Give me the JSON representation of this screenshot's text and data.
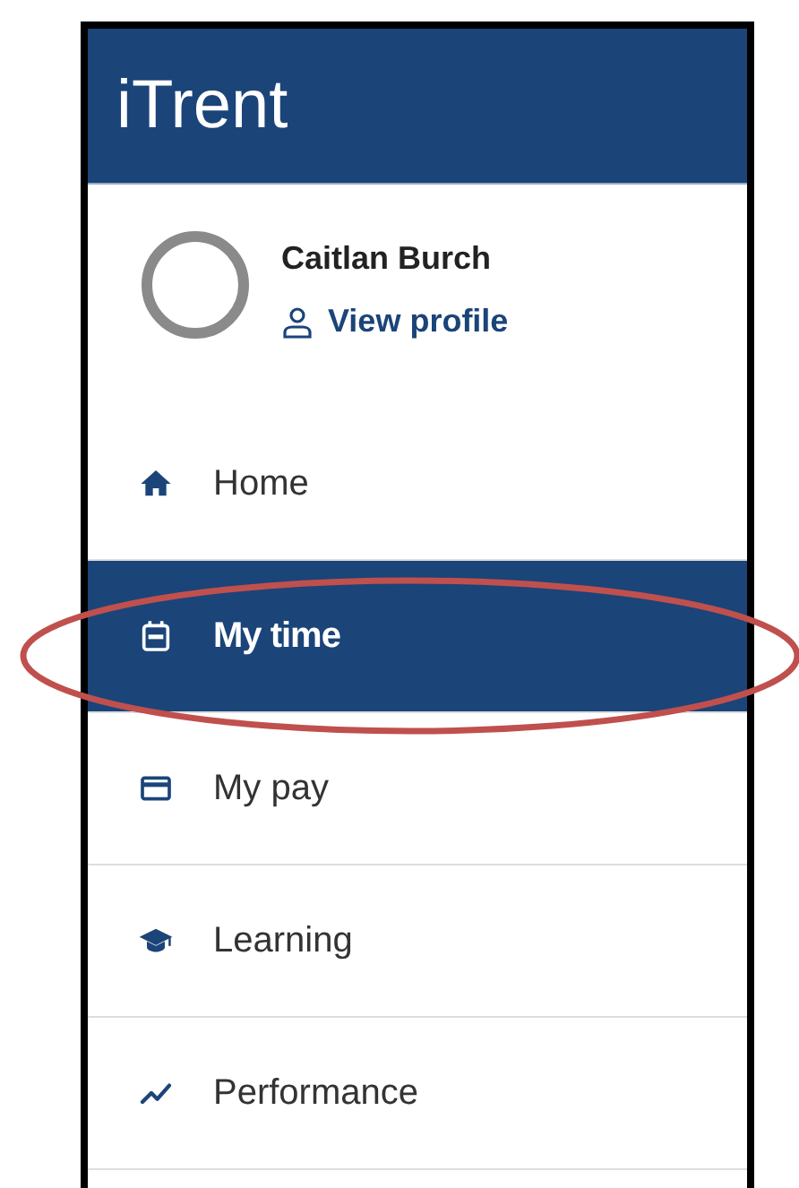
{
  "header": {
    "title": "iTrent"
  },
  "profile": {
    "name": "Caitlan Burch",
    "link": "View profile"
  },
  "nav": [
    {
      "label": "Home",
      "selected": false
    },
    {
      "label": "My time",
      "selected": true
    },
    {
      "label": "My pay",
      "selected": false
    },
    {
      "label": "Learning",
      "selected": false
    },
    {
      "label": "Performance",
      "selected": false
    }
  ],
  "annotation": {
    "kind": "ellipse"
  }
}
